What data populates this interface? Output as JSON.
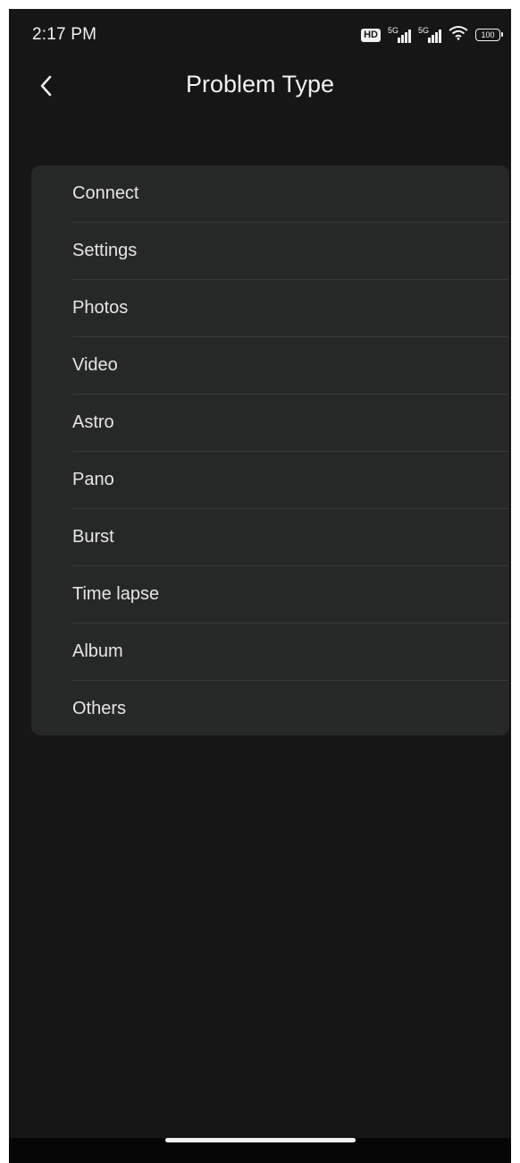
{
  "status_bar": {
    "time": "2:17 PM",
    "hd_label": "HD",
    "network_1": "5G",
    "network_2": "5G",
    "battery": "100"
  },
  "header": {
    "title": "Problem Type",
    "back_icon": "chevron-left-icon"
  },
  "problem_types": [
    "Connect",
    "Settings",
    "Photos",
    "Video",
    "Astro",
    "Pano",
    "Burst",
    "Time lapse",
    "Album",
    "Others"
  ],
  "colors": {
    "background": "#161616",
    "card": "#262727",
    "divider": "#383939",
    "text": "#e6e6e6"
  }
}
